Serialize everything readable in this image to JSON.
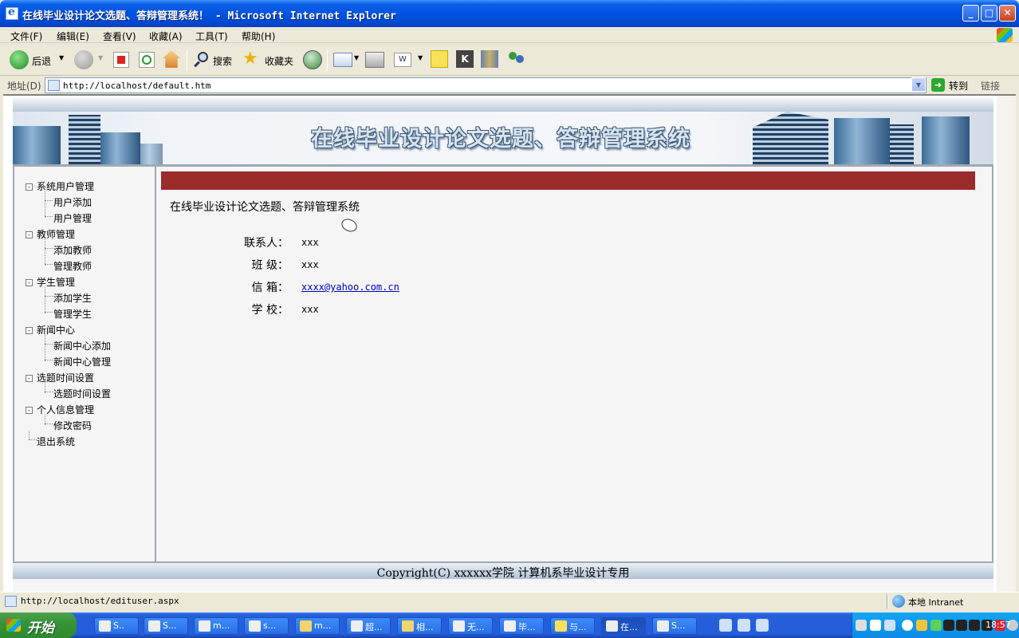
{
  "window": {
    "title": "在线毕业设计论文选题、答辩管理系统！ - Microsoft Internet Explorer",
    "min": "_",
    "max": "□",
    "close": "✕"
  },
  "menu": [
    "文件(F)",
    "编辑(E)",
    "查看(V)",
    "收藏(A)",
    "工具(T)",
    "帮助(H)"
  ],
  "toolbar": {
    "back": "后退",
    "search": "搜索",
    "favorites": "收藏夹"
  },
  "address": {
    "label": "地址(D)",
    "url": "http://localhost/default.htm",
    "go": "转到",
    "links": "链接"
  },
  "page": {
    "banner_title": "在线毕业设计论文选题、答辩管理系统",
    "sidebar": [
      {
        "label": "系统用户管理",
        "children": [
          "用户添加",
          "用户管理"
        ]
      },
      {
        "label": "教师管理",
        "children": [
          "添加教师",
          "管理教师"
        ]
      },
      {
        "label": "学生管理",
        "children": [
          "添加学生",
          "管理学生"
        ]
      },
      {
        "label": "新闻中心",
        "children": [
          "新闻中心添加",
          "新闻中心管理"
        ]
      },
      {
        "label": "选题时间设置",
        "children": [
          "选题时间设置"
        ]
      },
      {
        "label": "个人信息管理",
        "children": [
          "修改密码"
        ]
      }
    ],
    "logout": "退出系统",
    "content_title": "在线毕业设计论文选题、答辩管理系统",
    "info": [
      {
        "label": "联系人：",
        "value": "xxx"
      },
      {
        "label": "班 级：",
        "value": "xxx"
      },
      {
        "label": "信 箱：",
        "value": "xxxx@yahoo.com.cn"
      },
      {
        "label": "学 校：",
        "value": "xxx"
      }
    ],
    "copyright": "Copyright(C) xxxxxx学院 计算机系毕业设计专用"
  },
  "status": {
    "text": "http://localhost/edituser.aspx",
    "zone": "本地 Intranet"
  },
  "taskbar": {
    "start": "开始",
    "tasks": [
      "S..",
      "S...",
      "m...",
      "s...",
      "m...",
      "超...",
      "相...",
      "无...",
      "毕...",
      "与...",
      "在...",
      "S..."
    ],
    "clock": "18:57"
  },
  "colors": {
    "content_bar": "#9b2c2c",
    "xp_blue": "#0054e3",
    "start_green": "#379437"
  }
}
